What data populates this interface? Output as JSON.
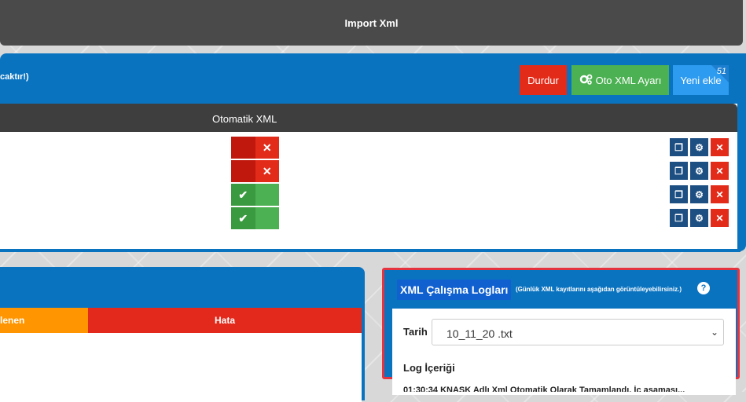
{
  "header": {
    "title": "Import Xml"
  },
  "top_panel": {
    "note": "caktır!)",
    "buttons": {
      "stop": "Durdur",
      "auto_xml": "Oto XML Ayarı",
      "new_add": "Yeni ekle",
      "new_badge": "51"
    },
    "table": {
      "column": "Otomatik XML",
      "rows": [
        {
          "status": "off"
        },
        {
          "status": "off"
        },
        {
          "status": "on"
        },
        {
          "status": "on"
        }
      ]
    }
  },
  "left_panel": {
    "col_orange": "lenen",
    "col_red": "Hata"
  },
  "logs": {
    "title": "XML Çalışma Logları",
    "subtitle": "(Günlük XML kayıtlarını aşağıdan görüntüleyebilirsiniz.)",
    "date_label": "Tarih",
    "date_value": "10_11_20     .txt",
    "content_label": "Log İçeriği",
    "log_line": "01:30:34 KNASK Adlı Xml Otomatik Olarak Tamamlandı. İç aşaması..."
  }
}
